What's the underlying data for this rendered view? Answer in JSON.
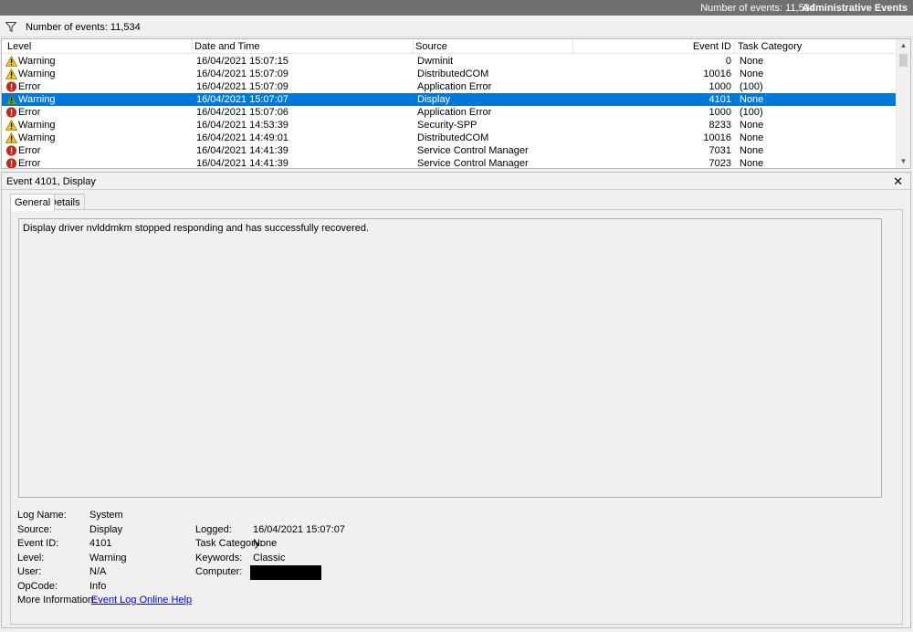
{
  "titlebar": {
    "count": "Number of events: 11,534",
    "view_name": "Administrative Events"
  },
  "filterbar": {
    "icon": "funnel-icon",
    "count": "Number of events: 11,534"
  },
  "grid": {
    "columns": {
      "level": "Level",
      "date": "Date and Time",
      "source": "Source",
      "event_id": "Event ID",
      "category": "Task Category"
    },
    "rows": [
      {
        "level": "Warning",
        "date": "16/04/2021 15:07:15",
        "source": "Dwminit",
        "event_id": "0",
        "category": "None"
      },
      {
        "level": "Warning",
        "date": "16/04/2021 15:07:09",
        "source": "DistributedCOM",
        "event_id": "10016",
        "category": "None"
      },
      {
        "level": "Error",
        "date": "16/04/2021 15:07:09",
        "source": "Application Error",
        "event_id": "1000",
        "category": "(100)"
      },
      {
        "level": "Warning",
        "date": "16/04/2021 15:07:07",
        "source": "Display",
        "event_id": "4101",
        "category": "None"
      },
      {
        "level": "Error",
        "date": "16/04/2021 15:07:06",
        "source": "Application Error",
        "event_id": "1000",
        "category": "(100)"
      },
      {
        "level": "Warning",
        "date": "16/04/2021 14:53:39",
        "source": "Security-SPP",
        "event_id": "8233",
        "category": "None"
      },
      {
        "level": "Warning",
        "date": "16/04/2021 14:49:01",
        "source": "DistributedCOM",
        "event_id": "10016",
        "category": "None"
      },
      {
        "level": "Error",
        "date": "16/04/2021 14:41:39",
        "source": "Service Control Manager",
        "event_id": "7031",
        "category": "None"
      },
      {
        "level": "Error",
        "date": "16/04/2021 14:41:39",
        "source": "Service Control Manager",
        "event_id": "7023",
        "category": "None"
      }
    ],
    "selected_row": 3
  },
  "detail": {
    "title": "Event 4101, Display",
    "close": "✕",
    "tabs": [
      "General",
      "Details"
    ],
    "message": "Display driver nvlddmkm stopped responding and has successfully recovered.",
    "labels": {
      "log_name": "Log Name:",
      "source": "Source:",
      "event_id": "Event ID:",
      "level": "Level:",
      "user": "User:",
      "opcode": "OpCode:",
      "more_info": "More Information:",
      "logged": "Logged:",
      "task_category": "Task Category:",
      "keywords": "Keywords:",
      "computer": "Computer:"
    },
    "values": {
      "log_name": "System",
      "source": "Display",
      "event_id": "4101",
      "level": "Warning",
      "user": "N/A",
      "opcode": "Info",
      "more_info": "Event Log Online Help",
      "logged": "16/04/2021 15:07:07",
      "task_category": "None",
      "keywords": "Classic"
    }
  },
  "colors": {
    "selection": "#0078d7",
    "warning": "#f5c400",
    "error": "#c42b1c",
    "titlebar": "#707070"
  }
}
